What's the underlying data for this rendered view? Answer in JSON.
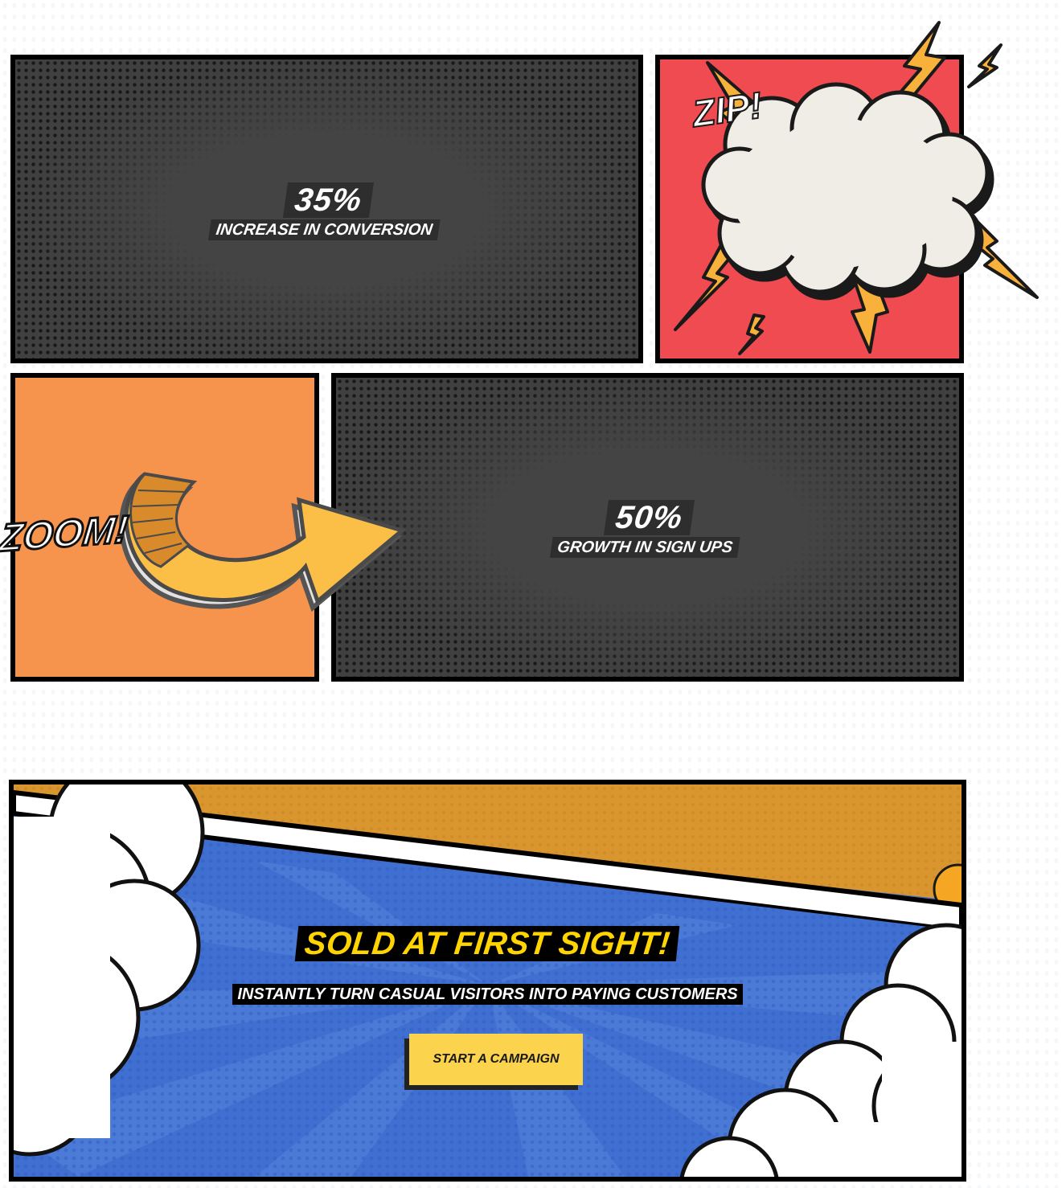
{
  "stats": [
    {
      "value": "35%",
      "label": "INCREASE IN CONVERSION"
    },
    {
      "value": "50%",
      "label": "GROWTH IN SIGN UPS"
    }
  ],
  "stickers": {
    "zip": "ZIP!",
    "zoom": "ZOOM!"
  },
  "cta": {
    "title": "SOLD AT FIRST SIGHT!",
    "subtitle": "INSTANTLY TURN CASUAL VISITORS INTO PAYING CUSTOMERS",
    "button_label": "START A CAMPAIGN"
  },
  "colors": {
    "panel_dark": "#404040",
    "panel_red": "#ef4b50",
    "panel_orange": "#f6944d",
    "bolt_yellow": "#f8b13a",
    "cta_blue": "#3f6fd0",
    "cta_gold": "#d9962e",
    "title_yellow": "#ffd400",
    "button_yellow": "#fcd34d"
  },
  "icons": {
    "bolt": "lightning-bolt-icon",
    "cloud": "explosion-cloud-icon",
    "arrow": "curved-arrow-icon"
  }
}
